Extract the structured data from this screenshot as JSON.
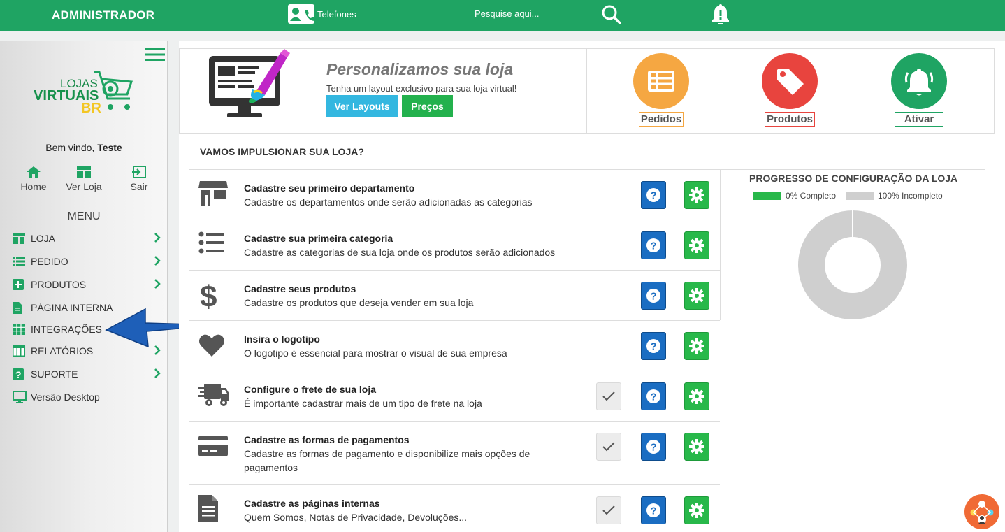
{
  "header": {
    "brand": "ADMINISTRADOR",
    "phones_label": "Telefones",
    "search_placeholder": "Pesquise aqui...",
    "bg_color": "#1fa463"
  },
  "sidebar": {
    "logo": {
      "line1": "LOJAS",
      "line2": "VIRTUAIS",
      "line3": "BR"
    },
    "welcome": "Bem vindo,",
    "user": "Teste",
    "quick_links": [
      {
        "label": "Home",
        "icon": "home-icon"
      },
      {
        "label": "Ver Loja",
        "icon": "store-icon"
      },
      {
        "label": "Sair",
        "icon": "logout-icon"
      }
    ],
    "menu_title": "MENU",
    "items": [
      {
        "label": "LOJA",
        "icon": "store-icon",
        "has_submenu": true
      },
      {
        "label": "PEDIDO",
        "icon": "list-icon",
        "has_submenu": true
      },
      {
        "label": "PRODUTOS",
        "icon": "plus-square-icon",
        "has_submenu": true
      },
      {
        "label": "PÁGINA INTERNA",
        "icon": "file-icon",
        "has_submenu": false
      },
      {
        "label": "INTEGRAÇÕES",
        "icon": "grid-icon",
        "has_submenu": false
      },
      {
        "label": "RELATÓRIOS",
        "icon": "table-icon",
        "has_submenu": true
      },
      {
        "label": "SUPORTE",
        "icon": "question-icon",
        "has_submenu": true
      },
      {
        "label": "Versão Desktop",
        "icon": "monitor-icon",
        "has_submenu": false
      }
    ]
  },
  "banner": {
    "title": "Personalizamos sua loja",
    "subtitle": "Tenha um layout exclusivo para sua loja virtual!",
    "btn_layouts": "Ver Layouts",
    "btn_precos": "Preços"
  },
  "shortcuts": [
    {
      "label": "Pedidos",
      "color": "#f5a742",
      "icon": "list-icon"
    },
    {
      "label": "Produtos",
      "color": "#e8443e",
      "icon": "tag-icon"
    },
    {
      "label": "Ativar",
      "color": "#1fa463",
      "icon": "bell-icon"
    }
  ],
  "boost_title": "VAMOS IMPULSIONAR SUA LOJA?",
  "steps": [
    {
      "title": "Cadastre seu primeiro departamento",
      "desc": "Cadastre os departamentos onde serão adicionadas as categorias",
      "icon": "store-icon",
      "done": false
    },
    {
      "title": "Cadastre sua primeira categoria",
      "desc": "Cadastre as categorias de sua loja onde os produtos serão adicionados",
      "icon": "list-icon",
      "done": false
    },
    {
      "title": "Cadastre seus produtos",
      "desc": "Cadastre os produtos que deseja vender em sua loja",
      "icon": "dollar-icon",
      "done": false
    },
    {
      "title": "Insira o logotipo",
      "desc": "O logotipo é essencial para mostrar o visual de sua empresa",
      "icon": "heart-icon",
      "done": false
    },
    {
      "title": "Configure o frete de sua loja",
      "desc": "É importante cadastrar mais de um tipo de frete na loja",
      "icon": "truck-icon",
      "done": true
    },
    {
      "title": "Cadastre as formas de pagamentos",
      "desc": "Cadastre as formas de pagamento e disponibilize mais opções de pagamentos",
      "icon": "credit-card-icon",
      "done": true
    },
    {
      "title": "Cadastre as páginas internas",
      "desc": "Quem Somos, Notas de Privacidade, Devoluções...",
      "icon": "file-icon",
      "done": true
    }
  ],
  "progress": {
    "title": "PROGRESSO DE CONFIGURAÇÃO DA LOJA",
    "legend_complete": "0% Completo",
    "legend_incomplete": "100% Incompleto",
    "complete_color": "#28b84a",
    "incomplete_color": "#cfcfcf"
  },
  "chart_data": {
    "type": "pie",
    "categories": [
      "Completo",
      "Incompleto"
    ],
    "values": [
      0,
      100
    ]
  }
}
